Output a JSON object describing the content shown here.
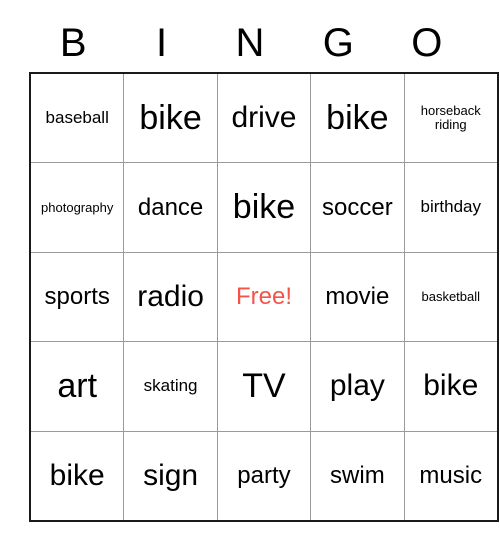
{
  "card": {
    "header_letters": [
      "B",
      "I",
      "N",
      "G",
      "O"
    ],
    "free_space_color": "#f4534a",
    "grid_line_color": "#9a9a9a",
    "border_color": "#1a1a1a",
    "rows": [
      [
        {
          "label": "baseball",
          "size": "sm",
          "free": false
        },
        {
          "label": "bike",
          "size": "xl",
          "free": false
        },
        {
          "label": "drive",
          "size": "lg",
          "free": false
        },
        {
          "label": "bike",
          "size": "xl",
          "free": false
        },
        {
          "label": "horseback\nriding",
          "size": "xs",
          "free": false
        }
      ],
      [
        {
          "label": "photography",
          "size": "xs",
          "free": false
        },
        {
          "label": "dance",
          "size": "md",
          "free": false
        },
        {
          "label": "bike",
          "size": "xl",
          "free": false
        },
        {
          "label": "soccer",
          "size": "md",
          "free": false
        },
        {
          "label": "birthday",
          "size": "sm",
          "free": false
        }
      ],
      [
        {
          "label": "sports",
          "size": "md",
          "free": false
        },
        {
          "label": "radio",
          "size": "lg",
          "free": false
        },
        {
          "label": "Free!",
          "size": "md",
          "free": true
        },
        {
          "label": "movie",
          "size": "md",
          "free": false
        },
        {
          "label": "basketball",
          "size": "xs",
          "free": false
        }
      ],
      [
        {
          "label": "art",
          "size": "xl",
          "free": false
        },
        {
          "label": "skating",
          "size": "sm",
          "free": false
        },
        {
          "label": "TV",
          "size": "xl",
          "free": false
        },
        {
          "label": "play",
          "size": "lg",
          "free": false
        },
        {
          "label": "bike",
          "size": "lg",
          "free": false
        }
      ],
      [
        {
          "label": "bike",
          "size": "lg",
          "free": false
        },
        {
          "label": "sign",
          "size": "lg",
          "free": false
        },
        {
          "label": "party",
          "size": "md",
          "free": false
        },
        {
          "label": "swim",
          "size": "md",
          "free": false
        },
        {
          "label": "music",
          "size": "md",
          "free": false
        }
      ]
    ]
  }
}
